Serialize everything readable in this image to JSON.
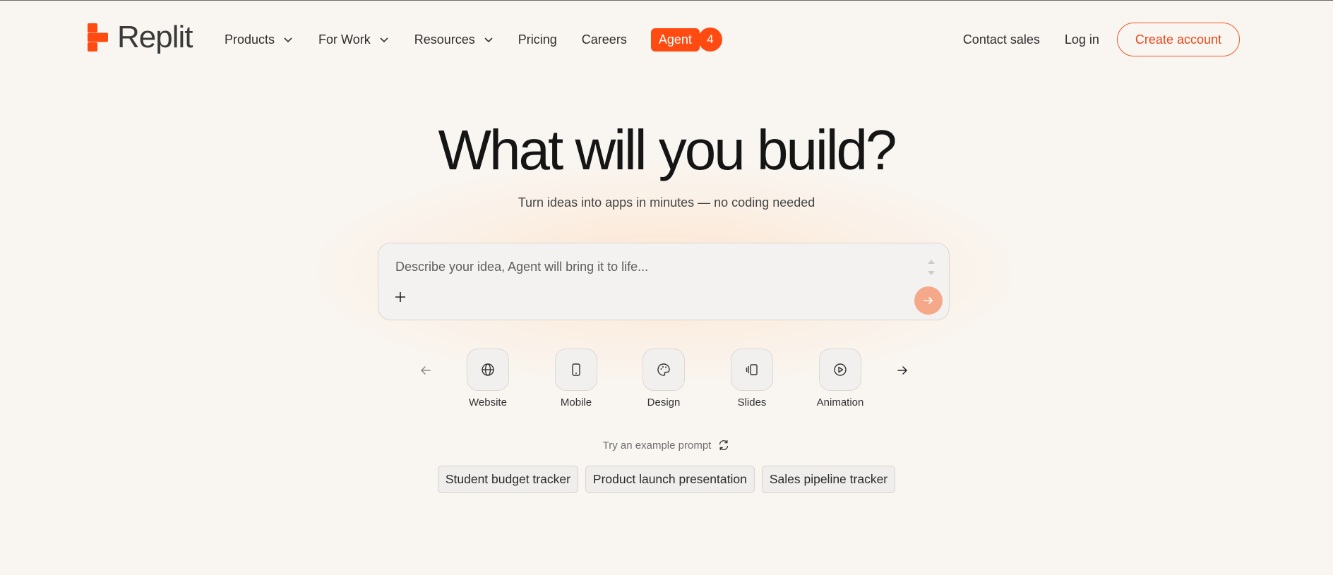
{
  "brand": {
    "name": "Replit",
    "accent_color": "#ff4b12"
  },
  "nav": {
    "items": [
      {
        "label": "Products",
        "has_dropdown": true
      },
      {
        "label": "For Work",
        "has_dropdown": true
      },
      {
        "label": "Resources",
        "has_dropdown": true
      },
      {
        "label": "Pricing",
        "has_dropdown": false
      },
      {
        "label": "Careers",
        "has_dropdown": false
      }
    ],
    "agent": {
      "label": "Agent",
      "badge": "4"
    },
    "contact_sales": "Contact sales",
    "log_in": "Log in",
    "create_account": "Create account"
  },
  "hero": {
    "title": "What will you build?",
    "subtitle": "Turn ideas into apps in minutes — no coding needed"
  },
  "prompt": {
    "placeholder": "Describe your idea, Agent will bring it to life...",
    "value": "",
    "attach_icon": "plus-icon",
    "submit_icon": "arrow-right-icon"
  },
  "categories": [
    {
      "label": "Website",
      "icon": "globe-icon"
    },
    {
      "label": "Mobile",
      "icon": "phone-icon"
    },
    {
      "label": "Design",
      "icon": "palette-icon"
    },
    {
      "label": "Slides",
      "icon": "slides-icon"
    },
    {
      "label": "Animation",
      "icon": "play-circle-icon"
    }
  ],
  "examples": {
    "label": "Try an example prompt",
    "refresh_icon": "refresh-icon",
    "items": [
      "Student budget tracker",
      "Product launch presentation",
      "Sales pipeline tracker"
    ]
  }
}
